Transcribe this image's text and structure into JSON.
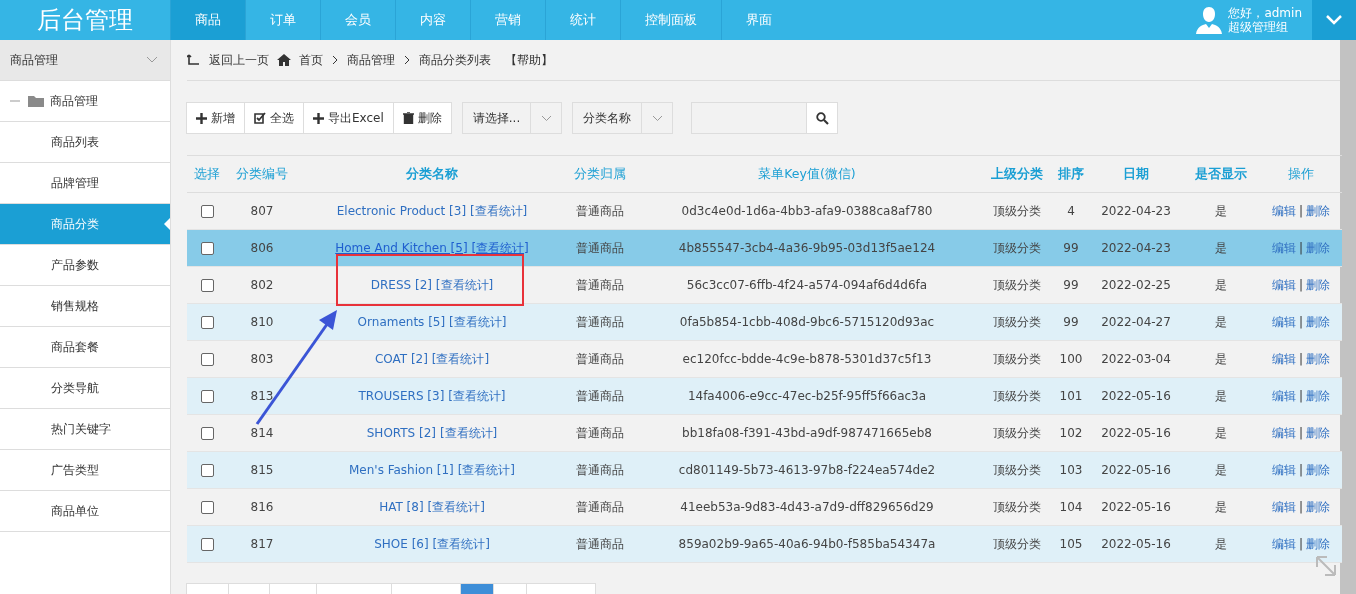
{
  "header": {
    "logo": "后台管理",
    "nav": [
      {
        "label": "商品",
        "selected": true
      },
      {
        "label": "订单",
        "selected": false
      },
      {
        "label": "会员",
        "selected": false
      },
      {
        "label": "内容",
        "selected": false
      },
      {
        "label": "营销",
        "selected": false
      },
      {
        "label": "统计",
        "selected": false
      },
      {
        "label": "控制面板",
        "selected": false
      },
      {
        "label": "界面",
        "selected": false
      }
    ],
    "user": {
      "greeting": "您好，admin",
      "group": "超级管理组"
    }
  },
  "sidebar": {
    "title": "商品管理",
    "folder": "商品管理",
    "items": [
      {
        "label": "商品列表",
        "selected": false
      },
      {
        "label": "品牌管理",
        "selected": false
      },
      {
        "label": "商品分类",
        "selected": true
      },
      {
        "label": "产品参数",
        "selected": false
      },
      {
        "label": "销售规格",
        "selected": false
      },
      {
        "label": "商品套餐",
        "selected": false
      },
      {
        "label": "分类导航",
        "selected": false
      },
      {
        "label": "热门关键字",
        "selected": false
      },
      {
        "label": "广告类型",
        "selected": false
      },
      {
        "label": "商品单位",
        "selected": false
      }
    ]
  },
  "breadcrumb": {
    "back": "返回上一页",
    "home": "首页",
    "path": [
      "商品管理",
      "商品分类列表"
    ],
    "help": "【帮助】"
  },
  "toolbar": {
    "buttons": [
      {
        "kind": "add",
        "label": "新增"
      },
      {
        "kind": "select_all",
        "label": "全选"
      },
      {
        "kind": "export",
        "label": "导出Excel"
      },
      {
        "kind": "delete",
        "label": "删除"
      }
    ],
    "dropdowns": [
      "请选择...",
      "分类名称"
    ]
  },
  "table": {
    "columns": [
      {
        "label": "选择",
        "sortable": false
      },
      {
        "label": "分类编号",
        "sortable": false
      },
      {
        "label": "分类名称",
        "sortable": true
      },
      {
        "label": "分类归属",
        "sortable": false
      },
      {
        "label": "菜单Key值(微信)",
        "sortable": false
      },
      {
        "label": "上级分类",
        "sortable": true
      },
      {
        "label": "排序",
        "sortable": true
      },
      {
        "label": "日期",
        "sortable": true
      },
      {
        "label": "是否显示",
        "sortable": true
      },
      {
        "label": "操作",
        "sortable": false
      }
    ],
    "rows": [
      {
        "checked": false,
        "highlighted": false,
        "id": "807",
        "name": "Electronic Product [3]",
        "stats": "[查看统计]",
        "owner": "普通商品",
        "key": "0d3c4e0d-1d6a-4bb3-afa9-0388ca8af780",
        "parent": "顶级分类",
        "order": "4",
        "date": "2022-04-23",
        "visible": "是",
        "edit": "编辑",
        "sep": "|",
        "delete": "删除"
      },
      {
        "checked": false,
        "highlighted": true,
        "id": "806",
        "name": "Home And Kitchen [5]",
        "stats": "[查看统计]",
        "owner": "普通商品",
        "key": "4b855547-3cb4-4a36-9b95-03d13f5ae124",
        "parent": "顶级分类",
        "order": "99",
        "date": "2022-04-23",
        "visible": "是",
        "edit": "编辑",
        "sep": "|",
        "delete": "删除"
      },
      {
        "checked": false,
        "highlighted": false,
        "id": "802",
        "name": "DRESS [2]",
        "stats": "[查看统计]",
        "owner": "普通商品",
        "key": "56c3cc07-6ffb-4f24-a574-094af6d4d6fa",
        "parent": "顶级分类",
        "order": "99",
        "date": "2022-02-25",
        "visible": "是",
        "edit": "编辑",
        "sep": "|",
        "delete": "删除"
      },
      {
        "checked": false,
        "highlighted": false,
        "id": "810",
        "name": "Ornaments [5]",
        "stats": "[查看统计]",
        "owner": "普通商品",
        "key": "0fa5b854-1cbb-408d-9bc6-5715120d93ac",
        "parent": "顶级分类",
        "order": "99",
        "date": "2022-04-27",
        "visible": "是",
        "edit": "编辑",
        "sep": "|",
        "delete": "删除"
      },
      {
        "checked": false,
        "highlighted": false,
        "id": "803",
        "name": "COAT [2]",
        "stats": "[查看统计]",
        "owner": "普通商品",
        "key": "ec120fcc-bdde-4c9e-b878-5301d37c5f13",
        "parent": "顶级分类",
        "order": "100",
        "date": "2022-03-04",
        "visible": "是",
        "edit": "编辑",
        "sep": "|",
        "delete": "删除"
      },
      {
        "checked": false,
        "highlighted": false,
        "id": "813",
        "name": "TROUSERS [3]",
        "stats": "[查看统计]",
        "owner": "普通商品",
        "key": "14fa4006-e9cc-47ec-b25f-95ff5f66ac3a",
        "parent": "顶级分类",
        "order": "101",
        "date": "2022-05-16",
        "visible": "是",
        "edit": "编辑",
        "sep": "|",
        "delete": "删除"
      },
      {
        "checked": false,
        "highlighted": false,
        "id": "814",
        "name": "SHORTS [2]",
        "stats": "[查看统计]",
        "owner": "普通商品",
        "key": "bb18fa08-f391-43bd-a9df-987471665eb8",
        "parent": "顶级分类",
        "order": "102",
        "date": "2022-05-16",
        "visible": "是",
        "edit": "编辑",
        "sep": "|",
        "delete": "删除"
      },
      {
        "checked": false,
        "highlighted": false,
        "id": "815",
        "name": "Men's Fashion [1]",
        "stats": "[查看统计]",
        "owner": "普通商品",
        "key": "cd801149-5b73-4613-97b8-f224ea574de2",
        "parent": "顶级分类",
        "order": "103",
        "date": "2022-05-16",
        "visible": "是",
        "edit": "编辑",
        "sep": "|",
        "delete": "删除"
      },
      {
        "checked": false,
        "highlighted": false,
        "id": "816",
        "name": "HAT [8]",
        "stats": "[查看统计]",
        "owner": "普通商品",
        "key": "41eeb53a-9d83-4d43-a7d9-dff829656d29",
        "parent": "顶级分类",
        "order": "104",
        "date": "2022-05-16",
        "visible": "是",
        "edit": "编辑",
        "sep": "|",
        "delete": "删除"
      },
      {
        "checked": false,
        "highlighted": false,
        "id": "817",
        "name": "SHOE [6]",
        "stats": "[查看统计]",
        "owner": "普通商品",
        "key": "859a02b9-9a65-40a6-94b0-f585ba54347a",
        "parent": "顶级分类",
        "order": "105",
        "date": "2022-05-16",
        "visible": "是",
        "edit": "编辑",
        "sep": "|",
        "delete": "删除"
      }
    ]
  },
  "pager": [
    {
      "selected": false
    },
    {
      "selected": false
    },
    {
      "selected": false
    },
    {
      "selected": false
    },
    {
      "selected": false
    },
    {
      "selected": true
    },
    {
      "selected": false
    },
    {
      "selected": false
    }
  ]
}
